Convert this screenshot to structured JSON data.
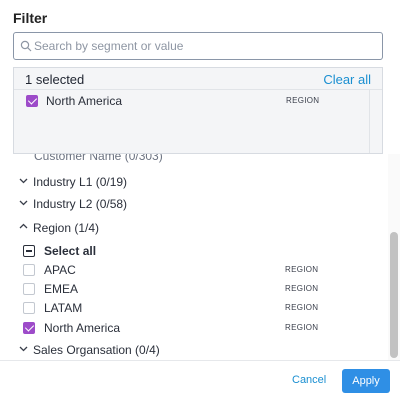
{
  "header": {
    "title": "Filter"
  },
  "search": {
    "placeholder": "Search by segment or value",
    "value": ""
  },
  "selected": {
    "count_label": "1 selected",
    "clear_label": "Clear all",
    "items": [
      {
        "label": "North America",
        "tag": "REGION",
        "checked": true
      }
    ]
  },
  "list": {
    "cut_label": "Customer Name (0/303)",
    "groups": [
      {
        "label": "Industry L1 (0/19)",
        "expanded": false
      },
      {
        "label": "Industry L2 (0/58)",
        "expanded": false
      },
      {
        "label": "Region (1/4)",
        "expanded": true
      }
    ],
    "select_all_label": "Select all",
    "region_items": [
      {
        "label": "APAC",
        "tag": "REGION",
        "checked": false
      },
      {
        "label": "EMEA",
        "tag": "REGION",
        "checked": false
      },
      {
        "label": "LATAM",
        "tag": "REGION",
        "checked": false
      },
      {
        "label": "North America",
        "tag": "REGION",
        "checked": true
      }
    ],
    "next_group": {
      "label": "Sales Organsation (0/4)",
      "expanded": false
    }
  },
  "footer": {
    "cancel_label": "Cancel",
    "apply_label": "Apply"
  },
  "colors": {
    "accent": "#9d4bc9",
    "link": "#1a8fd1",
    "primary_button": "#2f8fe5"
  }
}
